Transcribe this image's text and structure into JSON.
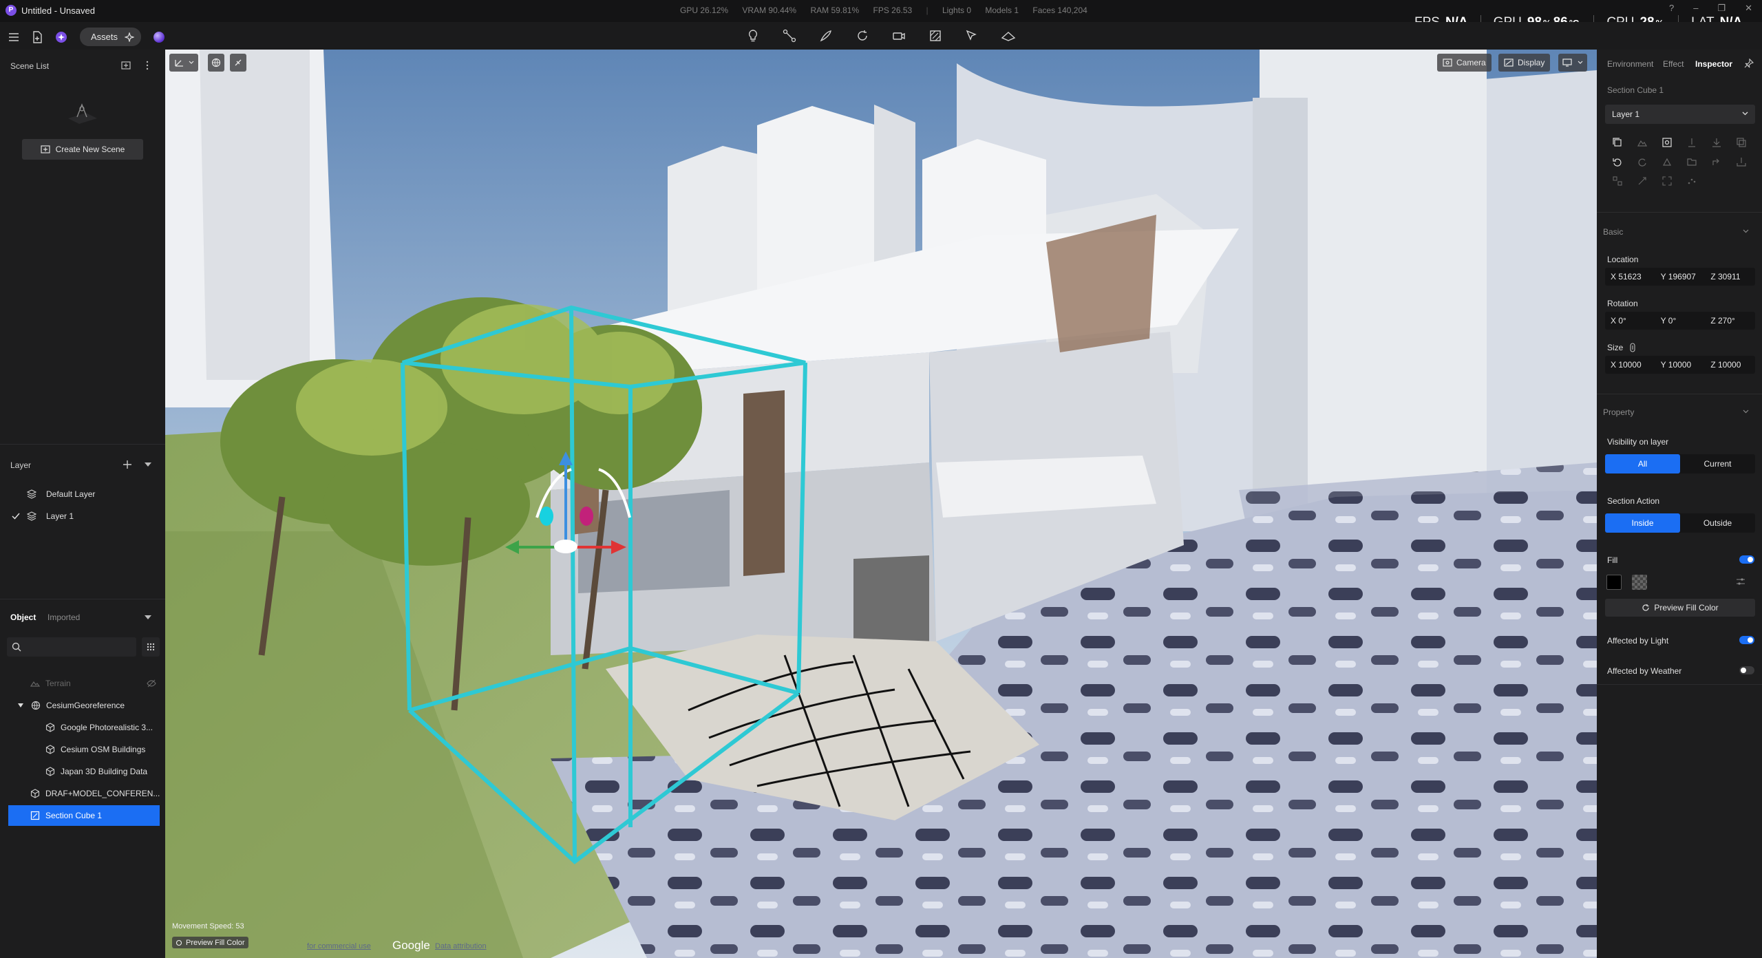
{
  "window": {
    "title": "Untitled - Unsaved",
    "app_icon": "P"
  },
  "stats": {
    "gpu": "GPU 26.12%",
    "vram": "VRAM 90.44%",
    "ram": "RAM 59.81%",
    "fps": "FPS 26.53",
    "lights": "Lights 0",
    "models": "Models 1",
    "faces": "Faces 140,204"
  },
  "perf": {
    "fps_label": "FPS",
    "fps_value": "N/A",
    "gpu_label": "GPU",
    "gpu_value": "98",
    "gpu_unit": "%",
    "gpu_temp": "86",
    "gpu_temp_unit": "°C",
    "cpu_label": "CPU",
    "cpu_value": "28",
    "cpu_unit": "%",
    "lat_label": "LAT",
    "lat_value": "N/A"
  },
  "toolbar": {
    "assets_label": "Assets",
    "center_tools": [
      "bulb-icon",
      "path-icon",
      "lasso-icon",
      "rotate-icon",
      "camera-icon",
      "section-icon",
      "pointer-icon",
      "terrain-icon"
    ]
  },
  "left": {
    "scene_list_title": "Scene List",
    "create_scene_label": "Create New Scene",
    "layer_title": "Layer",
    "layers": [
      {
        "name": "Default Layer",
        "checked": false
      },
      {
        "name": "Layer 1",
        "checked": true
      }
    ],
    "object_tab": "Object",
    "imported_tab": "Imported",
    "tree": [
      {
        "name": "Terrain",
        "level": 1,
        "dim": true
      },
      {
        "name": "CesiumGeoreference",
        "level": 0,
        "expanded": true
      },
      {
        "name": "Google Photorealistic 3...",
        "level": 2
      },
      {
        "name": "Cesium OSM Buildings",
        "level": 2
      },
      {
        "name": "Japan 3D Building Data",
        "level": 2
      },
      {
        "name": "DRAF+MODEL_CONFEREN...",
        "level": 1
      },
      {
        "name": "Section Cube 1",
        "level": 1,
        "selected": true
      }
    ]
  },
  "viewport": {
    "camera_label": "Camera",
    "display_label": "Display",
    "movement_speed": "Movement Speed: 53",
    "preview_fill": "Preview Fill Color",
    "commercial": "for commercial use",
    "google": "Google",
    "data_attr": "Data attribution"
  },
  "right": {
    "tabs": [
      "Environment",
      "Effect",
      "Inspector"
    ],
    "active_tab": "Inspector",
    "object_name": "Section Cube 1",
    "layer_select": "Layer 1",
    "basic_title": "Basic",
    "location_label": "Location",
    "location": {
      "x": "X  51623",
      "y": "Y  196907",
      "z": "Z  30911"
    },
    "rotation_label": "Rotation",
    "rotation": {
      "x": "X  0°",
      "y": "Y  0°",
      "z": "Z  270°"
    },
    "size_label": "Size",
    "size": {
      "x": "X  10000",
      "y": "Y  10000",
      "z": "Z  10000"
    },
    "property_title": "Property",
    "visibility_label": "Visibility on layer",
    "visibility_all": "All",
    "visibility_current": "Current",
    "section_action_label": "Section Action",
    "inside": "Inside",
    "outside": "Outside",
    "fill_label": "Fill",
    "fill_on": true,
    "preview_fill_btn": "Preview Fill Color",
    "affected_light": "Affected by Light",
    "affected_light_on": true,
    "affected_weather": "Affected by Weather",
    "affected_weather_on": false
  },
  "colors": {
    "accent": "#1b6ef3",
    "section_cube": "#2ec9d4",
    "panel": "#1d1d1e"
  }
}
